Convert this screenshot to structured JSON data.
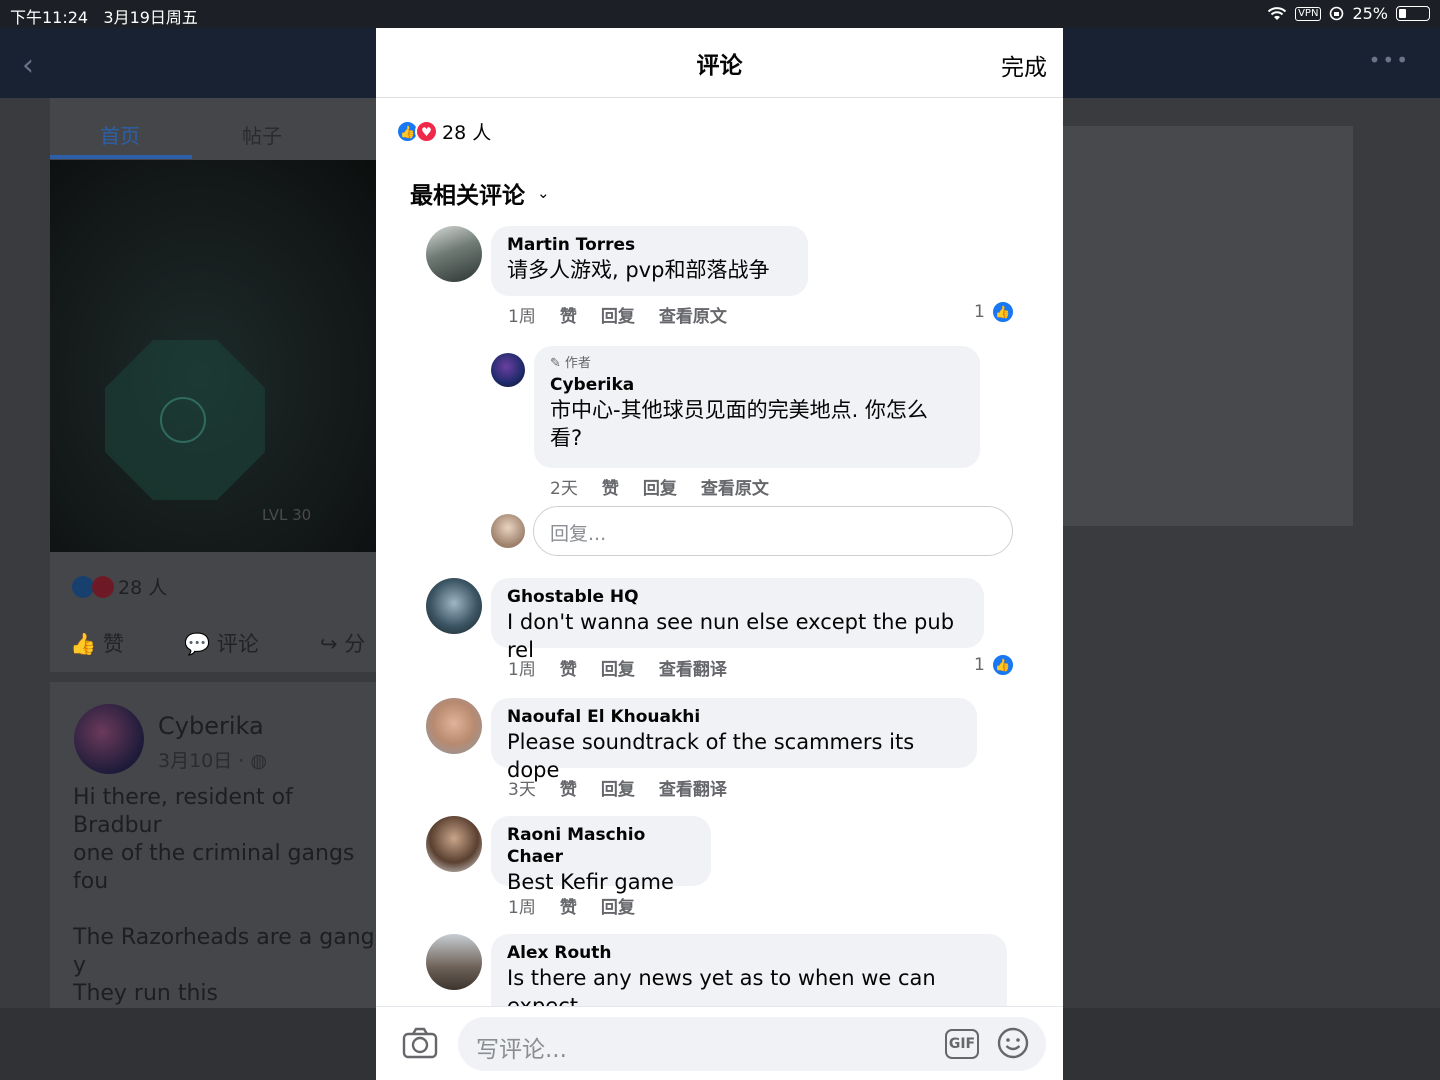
{
  "status_bar": {
    "time": "下午11:24",
    "date": "3月19日周五",
    "vpn": "VPN",
    "battery": "25%",
    "battery_level": 0.25
  },
  "background": {
    "tabs": [
      "首页",
      "帖子"
    ],
    "game_label": "LVL 30",
    "reactions_count": "28 人",
    "actions": {
      "like": "赞",
      "comment": "评论",
      "share": "分"
    },
    "post": {
      "author": "Cyberika",
      "date": "3月10日 · ",
      "text": "Hi there, resident of Bradbur\none of the criminal gangs fou\n\nThe Razorheads are a gang y\nThey run this neighborhood,\nnighttime stroll.\n... 展开\n查看翻译"
    }
  },
  "modal": {
    "title": "评论",
    "done": "完成",
    "reactions_count": "28 人",
    "sort_label": "最相关评论",
    "comments": [
      {
        "name": "Martin Torres",
        "text": "请多人游戏, pvp和部落战争",
        "time": "1周",
        "like": "赞",
        "reply": "回复",
        "extra": "查看原文",
        "likes": "1"
      },
      {
        "author_tag": "作者",
        "name": "Cyberika",
        "text": "市中心-其他球员见面的完美地点. 你怎么\n看?",
        "time": "2天",
        "like": "赞",
        "reply": "回复",
        "extra": "查看原文"
      },
      {
        "name": "Ghostable HQ",
        "text": "I don't wanna see nun else except the pub rel",
        "time": "1周",
        "like": "赞",
        "reply": "回复",
        "extra": "查看翻译",
        "likes": "1"
      },
      {
        "name": "Naoufal El Khouakhi",
        "text": "Please soundtrack of the scammers its dope",
        "time": "3天",
        "like": "赞",
        "reply": "回复",
        "extra": "查看翻译"
      },
      {
        "name": "Raoni Maschio Chaer",
        "text": "Best Kefir game",
        "time": "1周",
        "like": "赞",
        "reply": "回复"
      },
      {
        "name": "Alex Routh",
        "text": "Is there any news yet as to when we can expect"
      }
    ],
    "reply_placeholder": "回复...",
    "composer_placeholder": "写评论...",
    "gif_label": "GIF"
  }
}
